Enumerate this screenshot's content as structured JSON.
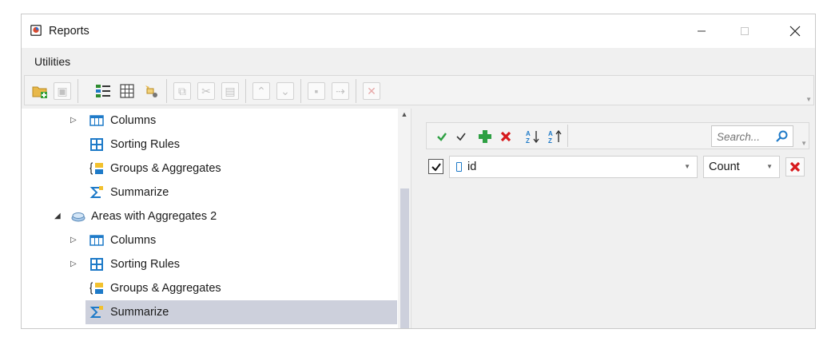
{
  "window": {
    "title": "Reports"
  },
  "menu": {
    "utilities": "Utilities"
  },
  "tree": {
    "items": [
      {
        "label": "Columns",
        "icon": "columns-icon",
        "expander": "▷"
      },
      {
        "label": "Sorting Rules",
        "icon": "sorting-rules-icon",
        "expander": ""
      },
      {
        "label": "Groups & Aggregates",
        "icon": "groups-aggregates-icon",
        "expander": ""
      },
      {
        "label": "Summarize",
        "icon": "summarize-icon",
        "expander": ""
      },
      {
        "label": "Areas with Aggregates 2",
        "icon": "report-icon",
        "expander": "◢"
      },
      {
        "label": "Columns",
        "icon": "columns-icon",
        "expander": "▷"
      },
      {
        "label": "Sorting Rules",
        "icon": "sorting-rules-icon",
        "expander": "▷"
      },
      {
        "label": "Groups & Aggregates",
        "icon": "groups-aggregates-icon",
        "expander": ""
      },
      {
        "label": "Summarize",
        "icon": "summarize-icon",
        "expander": "",
        "selected": true
      }
    ]
  },
  "filter": {
    "search_placeholder": "Search..."
  },
  "aggregate_row": {
    "checked": true,
    "field": "id",
    "function": "Count"
  },
  "colors": {
    "selection": "#cdd0dc",
    "green": "#2ea043",
    "red": "#d7191c",
    "blue": "#1e7ac8"
  }
}
